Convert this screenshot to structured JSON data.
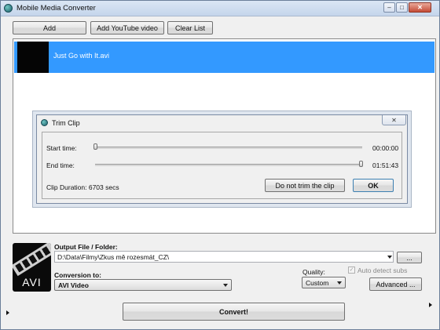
{
  "window": {
    "title": "Mobile Media Converter",
    "minimize": "–",
    "maximize": "□",
    "close": "✕"
  },
  "toolbar": {
    "add": "Add",
    "add_youtube": "Add YouTube video",
    "clear_list": "Clear List"
  },
  "file_list": {
    "items": [
      {
        "name": "Just Go with It.avi"
      }
    ]
  },
  "trim_dialog": {
    "title": "Trim Clip",
    "close": "✕",
    "start_label": "Start time:",
    "start_value": "00:00:00",
    "end_label": "End time:",
    "end_value": "01:51:43",
    "duration": "Clip Duration: 6703 secs",
    "no_trim_button": "Do not trim the clip",
    "ok_button": "OK"
  },
  "output": {
    "logo_text": "AVI",
    "folder_label": "Output File / Folder:",
    "folder_value": "D:\\Data\\Filmy\\Zkus mě rozesmát_CZ\\",
    "browse": "...",
    "conversion_label": "Conversion to:",
    "conversion_value": "AVI Video",
    "quality_label": "Quality:",
    "quality_value": "Custom",
    "auto_subs": "Auto detect subs",
    "auto_subs_checked": true,
    "advanced": "Advanced ...",
    "convert": "Convert!"
  },
  "colors": {
    "selection": "#3399ff",
    "window_bg": "#f0f0f0"
  }
}
